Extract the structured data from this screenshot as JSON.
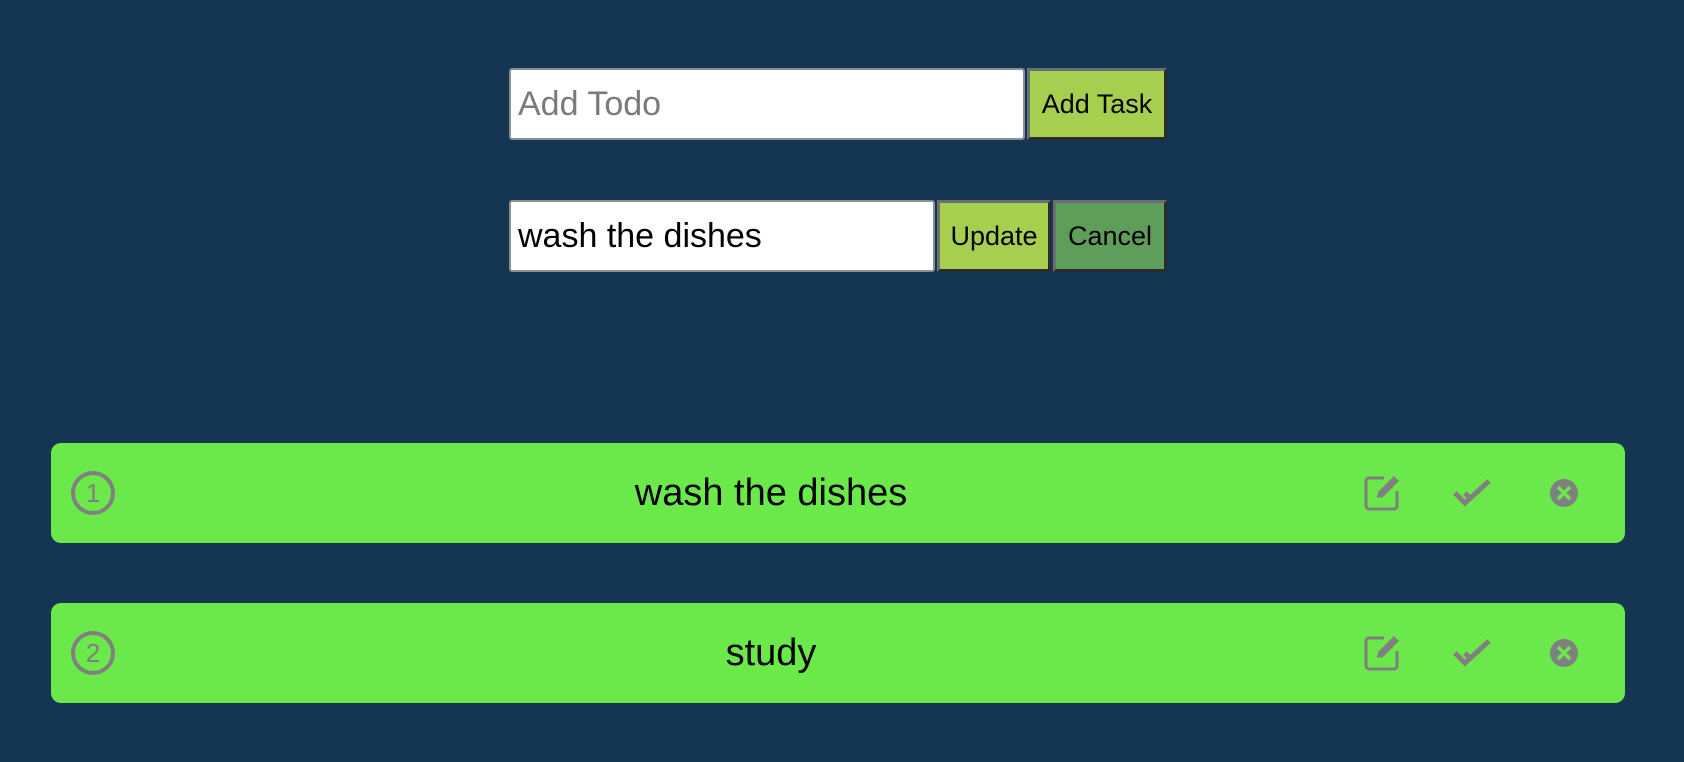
{
  "colors": {
    "background": "#143652",
    "item_background": "#6be84a",
    "add_button": "#a6cf4f",
    "update_button": "#a6cf4f",
    "cancel_button": "#5f9e5a",
    "icon_gray": "#808080"
  },
  "add_form": {
    "input_value": "",
    "input_placeholder": "Add Todo",
    "add_button_label": "Add Task"
  },
  "edit_form": {
    "input_value": "wash the dishes",
    "update_button_label": "Update",
    "cancel_button_label": "Cancel"
  },
  "todos": [
    {
      "number": "1",
      "title": "wash the dishes",
      "icons": [
        "edit-icon",
        "check-icon",
        "delete-icon"
      ]
    },
    {
      "number": "2",
      "title": "study",
      "icons": [
        "edit-icon",
        "check-icon",
        "delete-icon"
      ]
    }
  ]
}
